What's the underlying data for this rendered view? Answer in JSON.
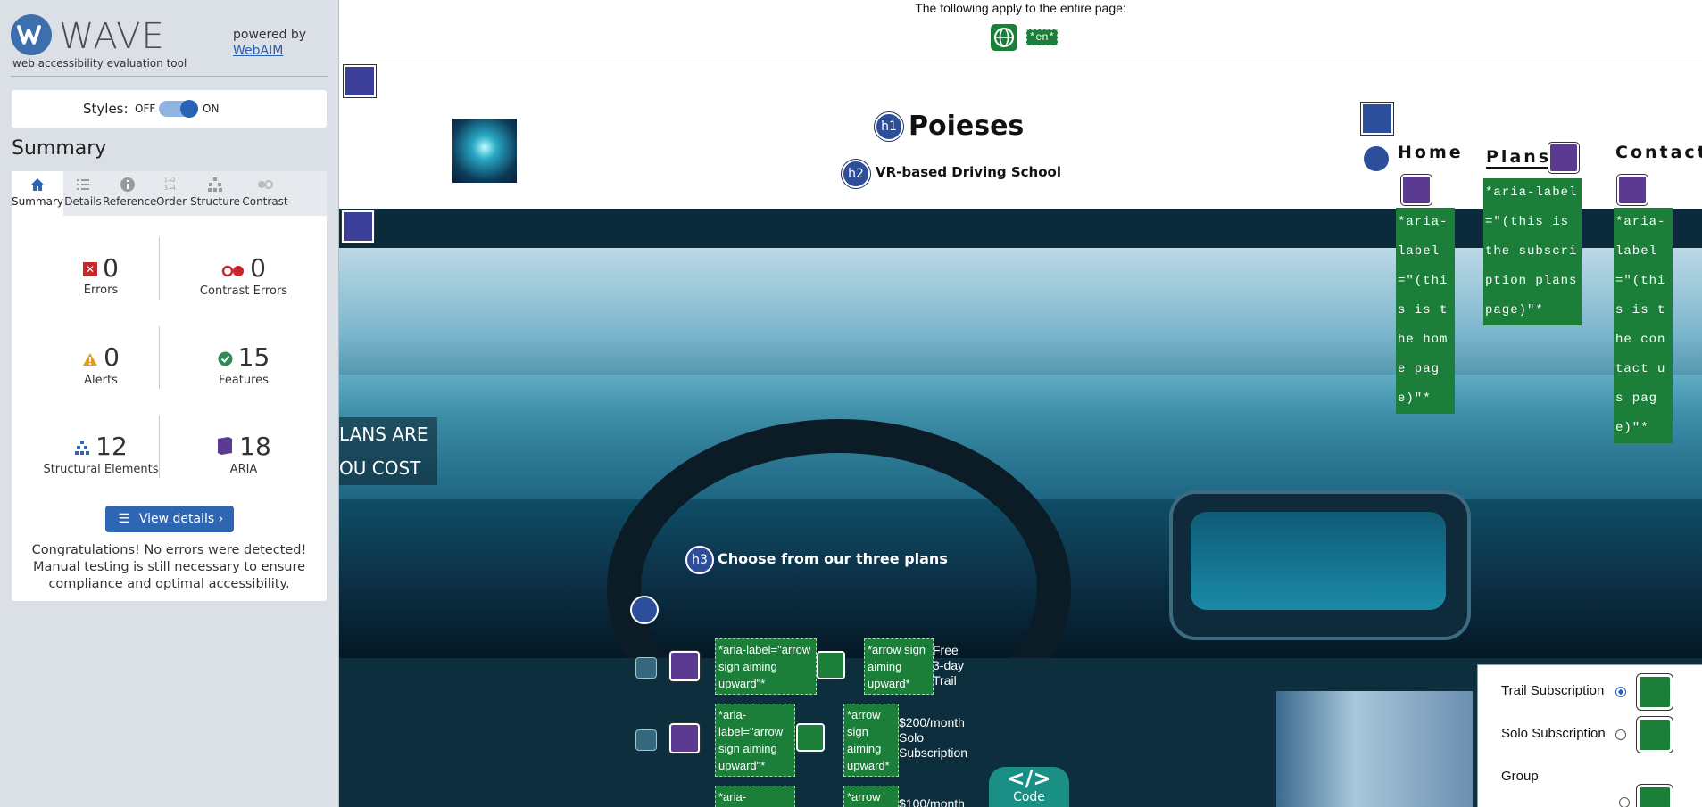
{
  "wave": {
    "logo_text": "WAVE",
    "logo_subtitle": "web accessibility evaluation tool",
    "powered_by": "powered by",
    "webaim_link": "WebAIM",
    "styles_label": "Styles:",
    "styles_off": "OFF",
    "styles_on": "ON",
    "summary_title": "Summary",
    "tabs": [
      {
        "label": "Summary",
        "icon": "home-icon"
      },
      {
        "label": "Details",
        "icon": "list-icon"
      },
      {
        "label": "Reference",
        "icon": "info-icon"
      },
      {
        "label": "Order",
        "icon": "order-icon"
      },
      {
        "label": "Structure",
        "icon": "structure-icon"
      },
      {
        "label": "Contrast",
        "icon": "contrast-icon"
      }
    ],
    "stats": {
      "errors": {
        "count": "0",
        "label": "Errors"
      },
      "contrast_errors": {
        "count": "0",
        "label": "Contrast Errors"
      },
      "alerts": {
        "count": "0",
        "label": "Alerts"
      },
      "features": {
        "count": "15",
        "label": "Features"
      },
      "structural": {
        "count": "12",
        "label": "Structural Elements"
      },
      "aria": {
        "count": "18",
        "label": "ARIA"
      }
    },
    "view_details_label": "View details ›",
    "congrats": "Congratulations! No errors were detected! Manual testing is still necessary to ensure compliance and optimal accessibility."
  },
  "page": {
    "doc_banner": "The following apply to the entire page:",
    "lang_tag": "*en*",
    "h1_badge": "h1",
    "h1": "Poieses",
    "h2_badge": "h2",
    "h2": "VR-based Driving School",
    "nav": {
      "home": "Home",
      "plans": "Plans",
      "contact": "Contact",
      "home_aria": "*aria-label=\"(this is the home page)\"*",
      "plans_aria": "*aria-label=\"(this is the subscription plans page)\"*",
      "contact_aria": "*aria-label=\"(this is the contact us page)\"*"
    },
    "plans_text_1": "LANS ARE",
    "plans_text_2": "OU COST",
    "h3_badge": "h3",
    "h3": "Choose from our three plans",
    "plan_rows": [
      {
        "aria": "*aria-label=\"arrow sign aiming upward\"*",
        "alt": "*arrow sign aiming upward*",
        "label": "Free 3-day Trail"
      },
      {
        "aria": "*aria-label=\"arrow sign aiming upward\"*",
        "alt": "*arrow sign aiming upward*",
        "label": "$200/month Solo Subscription"
      },
      {
        "aria": "*aria-",
        "alt": "*arrow",
        "label": "$100/month"
      }
    ],
    "code_label": "Code",
    "form": {
      "trail": "Trail Subscription",
      "solo": "Solo Subscription",
      "group": "Group"
    },
    "colors": {
      "feature_green": "#1b7f3a",
      "aria_purple": "#5a3b91",
      "structure_blue": "#2d4f9b"
    }
  }
}
